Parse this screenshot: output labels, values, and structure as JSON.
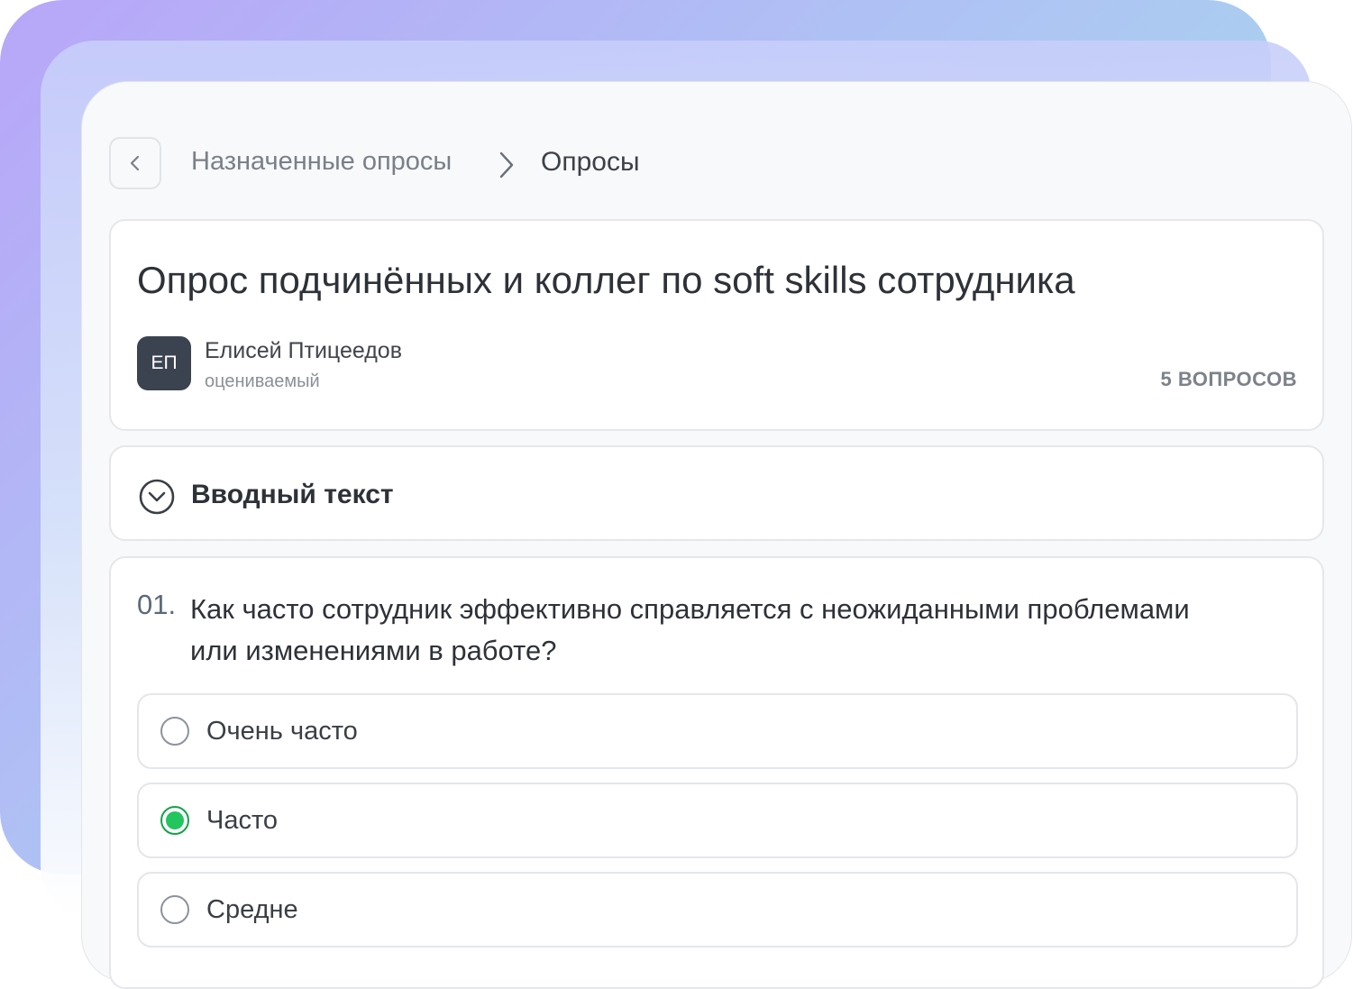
{
  "breadcrumb": {
    "parent": "Назначенные опросы",
    "current": "Опросы"
  },
  "survey": {
    "title": "Опрос подчинённых и коллег по soft skills сотрудника",
    "person": {
      "initials": "ЕП",
      "name": "Елисей Птицеедов",
      "role": "оцениваемый"
    },
    "question_count": "5 ВОПРОСОВ"
  },
  "intro": {
    "label": "Вводный текст"
  },
  "question": {
    "number": "01.",
    "text": "Как часто сотрудник эффективно справляется с неожиданными проблемами или изменениями в работе?",
    "options": [
      {
        "label": "Очень часто",
        "selected": false
      },
      {
        "label": "Часто",
        "selected": true
      },
      {
        "label": "Средне",
        "selected": false
      }
    ]
  },
  "colors": {
    "selected_radio": "#22c55e",
    "avatar_bg": "#3b4350"
  },
  "icons": {
    "back": "chevron-left-icon",
    "separator": "chevron-right-icon",
    "expand": "chevron-down-circle-icon"
  }
}
